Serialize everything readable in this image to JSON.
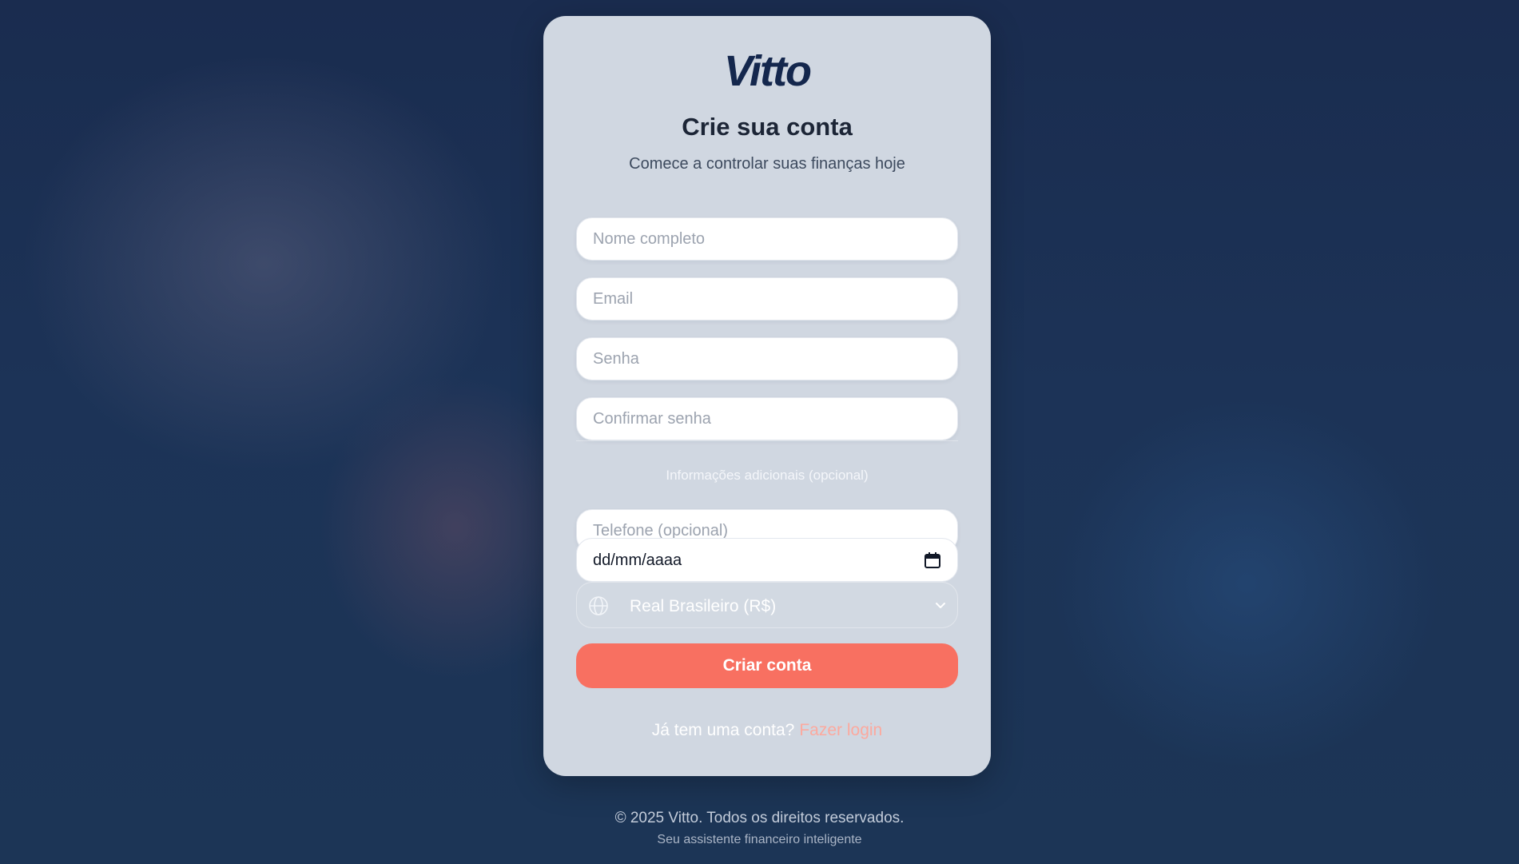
{
  "brand": {
    "logo_text": "Vitto"
  },
  "header": {
    "title": "Crie sua conta",
    "subtitle": "Comece a controlar suas finanças hoje"
  },
  "form": {
    "name_placeholder": "Nome completo",
    "email_placeholder": "Email",
    "password_placeholder": "Senha",
    "confirm_password_placeholder": "Confirmar senha",
    "optional_section_label": "Informações adicionais (opcional)",
    "phone_placeholder": "Telefone (opcional)",
    "birthdate_display": "dd/mm/aaaa",
    "currency_selected": "Real Brasileiro (R$)",
    "submit_label": "Criar conta"
  },
  "login": {
    "prompt": "Já tem uma conta?",
    "link_label": "Fazer login"
  },
  "footer": {
    "copyright": "© 2025 Vitto. Todos os direitos reservados.",
    "tagline": "Seu assistente financeiro inteligente"
  },
  "colors": {
    "background": "#1c3153",
    "card": "#d0d7e1",
    "brand_navy": "#14274d",
    "accent_coral": "#f87061",
    "link_coral": "#fca99e"
  },
  "icons": {
    "date": "calendar-icon",
    "currency": "globe-icon",
    "dropdown": "chevron-down-icon"
  }
}
